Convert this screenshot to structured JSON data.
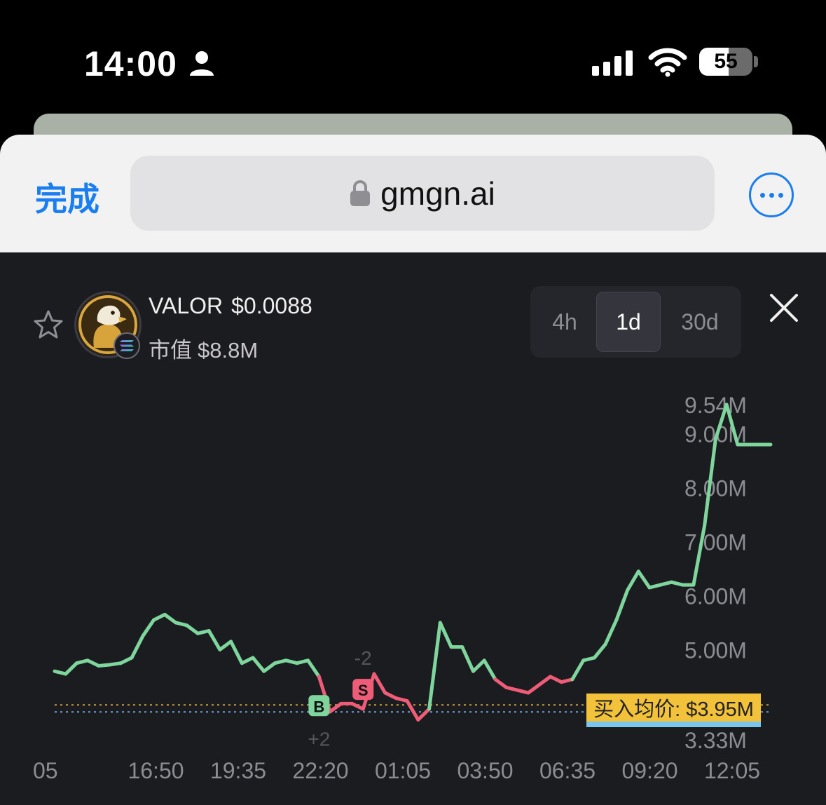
{
  "status_bar": {
    "time": "14:00",
    "battery": "55",
    "battery_level": 0.55
  },
  "browser": {
    "done_label": "完成",
    "url": "gmgn.ai",
    "more_icon": "ellipsis-circle-icon"
  },
  "token": {
    "symbol": "VALOR",
    "price": "$0.0088",
    "mcap_label": "市值",
    "mcap_value": "$8.8M",
    "chain_icon": "solana-icon",
    "avatar": "eagle-avatar"
  },
  "timeframes": [
    {
      "label": "4h",
      "active": false
    },
    {
      "label": "1d",
      "active": true
    },
    {
      "label": "30d",
      "active": false
    }
  ],
  "colors": {
    "up": "#7fd69c",
    "down": "#ef5c78",
    "accent": "#1a7ef0",
    "avg_tag": "#f3c23b"
  },
  "avg_price_label": "买入均价: $3.95M",
  "chart_data": {
    "type": "line",
    "y_ticks": [
      "9.54M",
      "9.00M",
      "8.00M",
      "7.00M",
      "6.00M",
      "5.00M",
      "3.33M"
    ],
    "x_ticks": [
      "05",
      "16:50",
      "19:35",
      "22:20",
      "01:05",
      "03:50",
      "06:35",
      "09:20",
      "12:05"
    ],
    "ylim": [
      3.33,
      9.54
    ],
    "avg_buy_price": 3.95,
    "markers": [
      {
        "label": "B",
        "x": 12,
        "y": 3.95,
        "note": "+2"
      },
      {
        "label": "S",
        "x": 14,
        "y": 4.25,
        "note": "-2"
      }
    ],
    "x": [
      0,
      0.5,
      1,
      1.5,
      2,
      2.5,
      3,
      3.5,
      4,
      4.5,
      5,
      5.5,
      6,
      6.5,
      7,
      7.5,
      8,
      8.5,
      9,
      9.5,
      10,
      10.5,
      11,
      11.5,
      12,
      12.5,
      13,
      13.5,
      14,
      14.5,
      15,
      15.5,
      16,
      16.5,
      17,
      17.5,
      18,
      18.5,
      19,
      19.5,
      20,
      20.5,
      21,
      21.5,
      22,
      22.5,
      23,
      23.5,
      24,
      24.5,
      25,
      25.5,
      26,
      26.5,
      27,
      27.5,
      28,
      28.5,
      29,
      29.5,
      30,
      30.5,
      31,
      31.5,
      32,
      32.5
    ],
    "values": [
      4.6,
      4.55,
      4.75,
      4.8,
      4.7,
      4.72,
      4.75,
      4.85,
      5.25,
      5.55,
      5.65,
      5.5,
      5.45,
      5.3,
      5.35,
      5.0,
      5.15,
      4.75,
      4.85,
      4.6,
      4.75,
      4.8,
      4.75,
      4.8,
      4.5,
      3.85,
      4.0,
      4.0,
      3.9,
      4.55,
      4.2,
      4.1,
      4.05,
      3.7,
      3.9,
      5.5,
      5.05,
      5.05,
      4.6,
      4.8,
      4.45,
      4.3,
      4.25,
      4.2,
      4.35,
      4.5,
      4.4,
      4.45,
      4.8,
      4.85,
      5.1,
      5.55,
      6.1,
      6.45,
      6.15,
      6.2,
      6.25,
      6.2,
      6.2,
      7.3,
      8.9,
      9.54,
      8.8,
      8.8,
      8.8,
      8.8
    ]
  }
}
